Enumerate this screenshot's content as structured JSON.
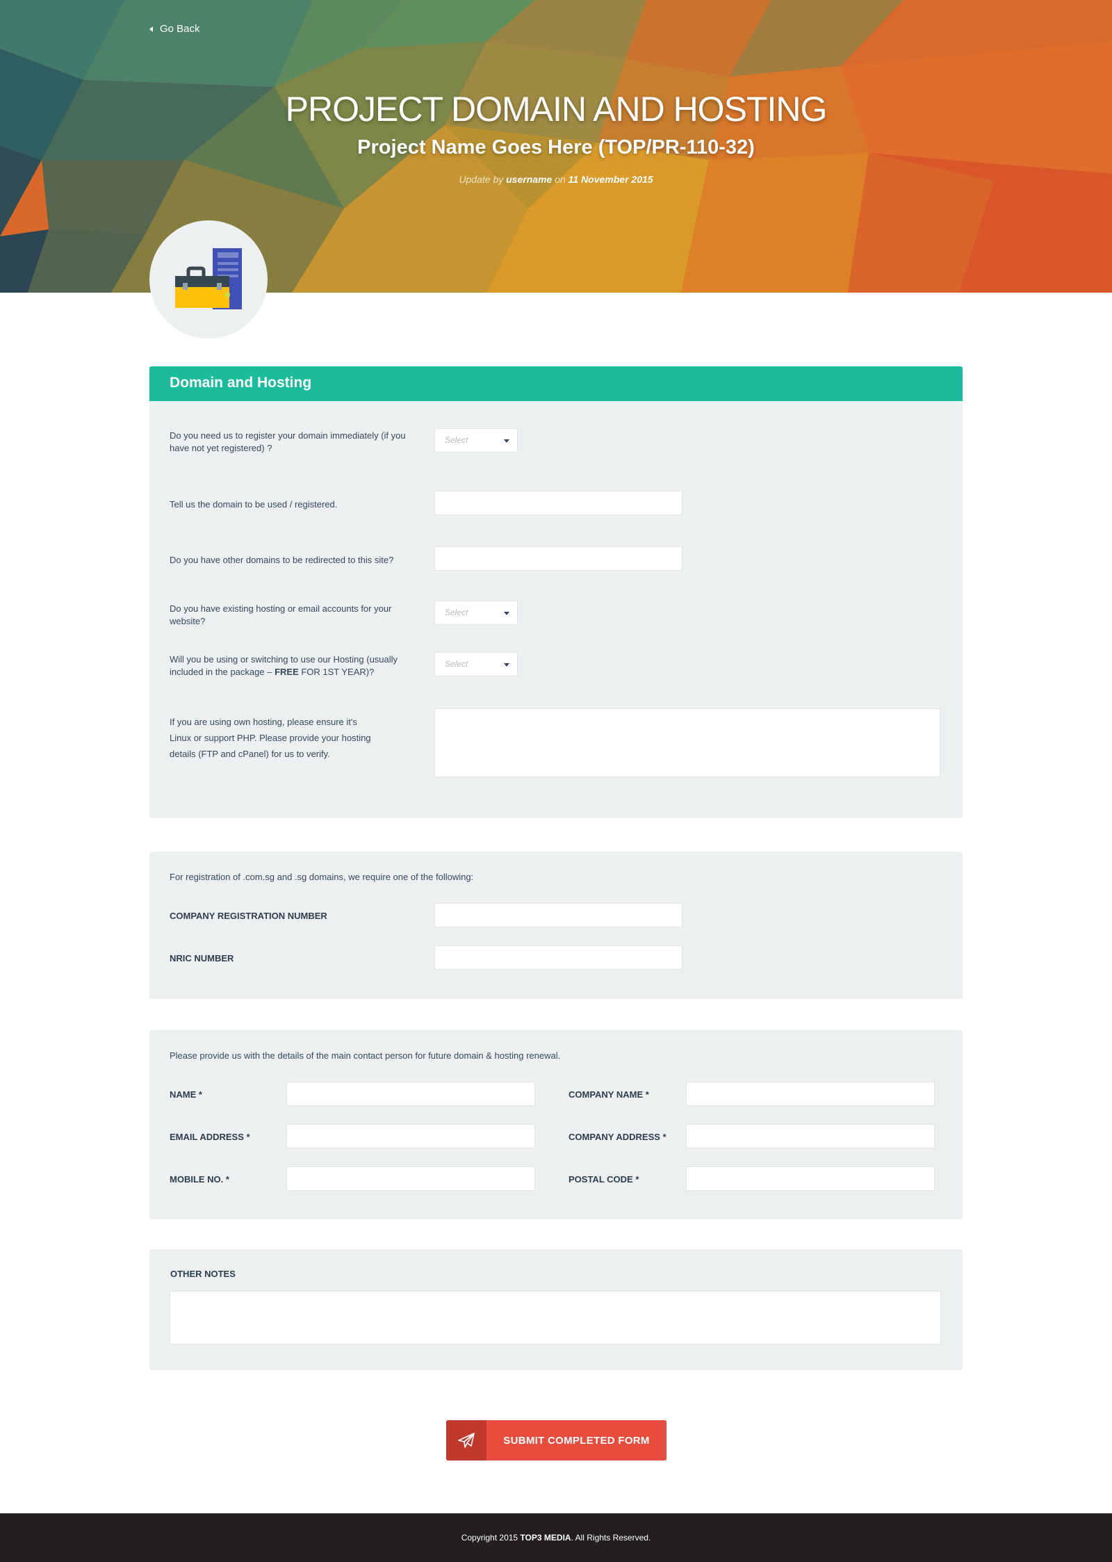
{
  "hero": {
    "back_label": "Go Back",
    "title": "PROJECT DOMAIN AND HOSTING",
    "subtitle": "Project Name Goes Here (TOP/PR-110-32)",
    "meta_prefix": "Update by",
    "meta_user": "username",
    "meta_on": "on",
    "meta_date": "11 November 2015"
  },
  "domain_section": {
    "title": "Domain and Hosting",
    "q1": "Do you need us to register your domain immediately (if you have not yet registered) ?",
    "q2": "Tell us the domain to be used / registered.",
    "q3": "Do you have other domains to be redirected to this site?",
    "q4": "Do you have existing hosting or email accounts for your website?",
    "q5_pre": "Will you be using or switching to use our Hosting (usually included in the package – ",
    "q5_bold": "FREE",
    "q5_post": " FOR 1ST YEAR)?",
    "q6": "If you are using own hosting, please ensure it's Linux or support PHP. Please provide your hosting details (FTP and cPanel) for us to verify.",
    "select_placeholder": "Select"
  },
  "sg_section": {
    "intro": "For registration of .com.sg and .sg domains, we require one of the following:",
    "company_reg_label": "COMPANY REGISTRATION NUMBER",
    "nric_label": "NRIC NUMBER"
  },
  "contact_section": {
    "intro": "Please provide us with the details of the main contact person for future domain & hosting renewal.",
    "name_label": "NAME",
    "email_label": "EMAIL ADDRESS",
    "mobile_label": "MOBILE NO.",
    "company_name_label": "COMPANY NAME",
    "company_address_label": "COMPANY ADDRESS",
    "postal_label": "POSTAL CODE",
    "required_mark": "*"
  },
  "notes_section": {
    "label": "OTHER NOTES"
  },
  "submit": {
    "label": "SUBMIT COMPLETED FORM"
  },
  "footer": {
    "prefix": "Copyright 2015",
    "brand": "TOP3 MEDIA",
    "suffix": ". All Rights Reserved."
  },
  "colors": {
    "accent": "#1abc9c",
    "submit": "#e74c3c",
    "submit_icon_bg": "#c0392b",
    "panel_bg": "#ecf0f1",
    "footer_bg": "#231f20"
  },
  "icons": {
    "back": "caret-left-icon",
    "avatar": "briefcase-server-icon",
    "submit": "paper-plane-icon",
    "select_arrow": "caret-down-icon"
  }
}
